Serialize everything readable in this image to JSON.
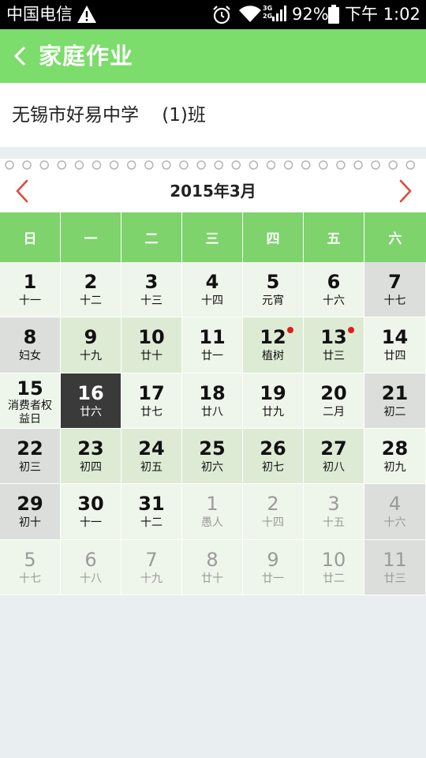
{
  "status_bar": {
    "carrier": "中国电信",
    "network": "3G 2G",
    "battery": "92%",
    "time": "下午 1:02"
  },
  "app_bar": {
    "back_icon": "chevron-left-icon",
    "title": "家庭作业"
  },
  "school": {
    "name": "无锡市好易中学    (1)班"
  },
  "calendar": {
    "month_title": "2015年3月",
    "prev_icon": "chevron-left-icon",
    "next_icon": "chevron-right-icon",
    "weekdays": [
      "日",
      "一",
      "二",
      "三",
      "四",
      "五",
      "六"
    ],
    "colors": {
      "header_green": "#7ed36c",
      "weekend_bg": "#dcdedc",
      "weekday_light": "#eef5ea",
      "weekday_green": "#ddebd4",
      "selected": "#3a3a3a",
      "dot": "#e21b1b",
      "nav_arrow": "#e04a3c"
    },
    "days": [
      {
        "num": "1",
        "lunar": "十一"
      },
      {
        "num": "2",
        "lunar": "十二"
      },
      {
        "num": "3",
        "lunar": "十三"
      },
      {
        "num": "4",
        "lunar": "十四"
      },
      {
        "num": "5",
        "lunar": "元宵"
      },
      {
        "num": "6",
        "lunar": "十六"
      },
      {
        "num": "7",
        "lunar": "十七"
      },
      {
        "num": "8",
        "lunar": "妇女"
      },
      {
        "num": "9",
        "lunar": "十九"
      },
      {
        "num": "10",
        "lunar": "廿十"
      },
      {
        "num": "11",
        "lunar": "廿一"
      },
      {
        "num": "12",
        "lunar": "植树",
        "dot": true
      },
      {
        "num": "13",
        "lunar": "廿三",
        "dot": true
      },
      {
        "num": "14",
        "lunar": "廿四"
      },
      {
        "num": "15",
        "lunar": "消费者权益日"
      },
      {
        "num": "16",
        "lunar": "廿六",
        "selected": true
      },
      {
        "num": "17",
        "lunar": "廿七"
      },
      {
        "num": "18",
        "lunar": "廿八"
      },
      {
        "num": "19",
        "lunar": "廿九"
      },
      {
        "num": "20",
        "lunar": "二月"
      },
      {
        "num": "21",
        "lunar": "初二"
      },
      {
        "num": "22",
        "lunar": "初三"
      },
      {
        "num": "23",
        "lunar": "初四"
      },
      {
        "num": "24",
        "lunar": "初五"
      },
      {
        "num": "25",
        "lunar": "初六"
      },
      {
        "num": "26",
        "lunar": "初七"
      },
      {
        "num": "27",
        "lunar": "初八"
      },
      {
        "num": "28",
        "lunar": "初九"
      },
      {
        "num": "29",
        "lunar": "初十"
      },
      {
        "num": "30",
        "lunar": "十一"
      },
      {
        "num": "31",
        "lunar": "十二"
      },
      {
        "num": "1",
        "lunar": "愚人",
        "other": true
      },
      {
        "num": "2",
        "lunar": "十四",
        "other": true
      },
      {
        "num": "3",
        "lunar": "十五",
        "other": true
      },
      {
        "num": "4",
        "lunar": "十六",
        "other": true
      },
      {
        "num": "5",
        "lunar": "十七",
        "other": true
      },
      {
        "num": "6",
        "lunar": "十八",
        "other": true
      },
      {
        "num": "7",
        "lunar": "十九",
        "other": true
      },
      {
        "num": "8",
        "lunar": "廿十",
        "other": true
      },
      {
        "num": "9",
        "lunar": "廿一",
        "other": true
      },
      {
        "num": "10",
        "lunar": "廿二",
        "other": true
      },
      {
        "num": "11",
        "lunar": "廿三",
        "other": true
      }
    ]
  }
}
